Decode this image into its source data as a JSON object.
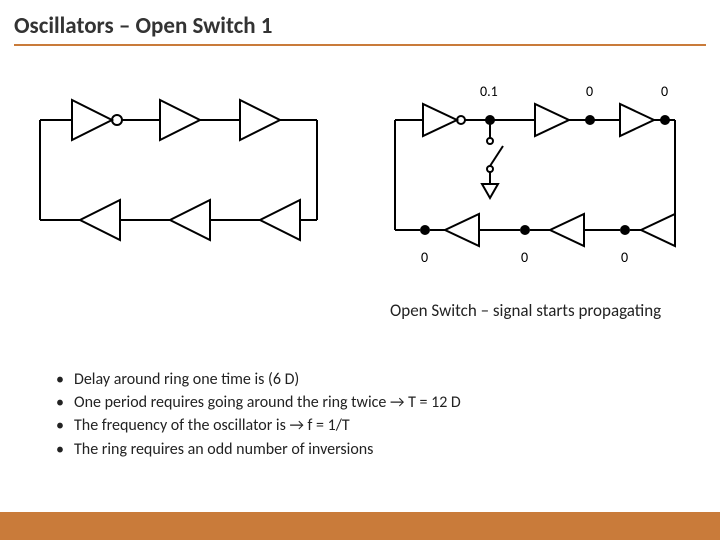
{
  "title": "Oscillators – Open Switch 1",
  "caption": "Open Switch – signal starts propagating",
  "bullets": [
    "Delay around ring one time is (6 D)",
    "One period requires going around the ring twice → T = 12 D",
    "The frequency of the oscillator is → f = 1/T",
    "The ring requires an odd number of inversions"
  ],
  "diagram_right": {
    "node_labels": [
      "0.1",
      "0",
      "0",
      "0",
      "0",
      "0"
    ]
  },
  "colors": {
    "accent": "#c97b3a"
  }
}
